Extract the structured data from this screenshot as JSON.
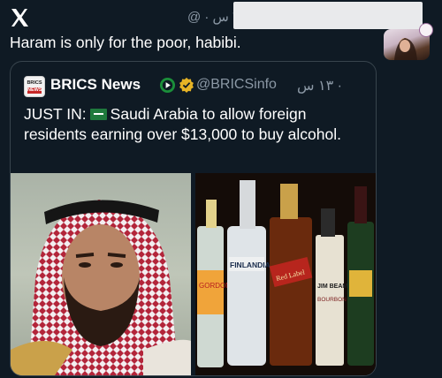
{
  "header": {
    "logo_icon": "x-logo-icon",
    "meta": "٧ س · @"
  },
  "tweet": {
    "text": "Haram is only for the poor, habibi."
  },
  "quote": {
    "avatar_line1": "BRICS",
    "avatar_line2": "NEWS",
    "name": "BRICS News",
    "badge_icons": [
      "play-badge-icon",
      "gold-verified-icon"
    ],
    "handle": "@BRICSinfo",
    "time": "· ١٣ س",
    "text_before_flag": "JUST IN:",
    "flag_icon": "saudi-flag-icon",
    "text_after_flag": "Saudi Arabia to allow foreign residents earning over $13,000 to buy alcohol.",
    "image_left_label": "crown-prince-photo",
    "image_right_label": "alcohol-bottles-photo",
    "bottle_labels": [
      "FINLANDIA",
      "Red Label",
      "JIM BEAM",
      "GORDON'S",
      "BOURBON"
    ]
  },
  "colors": {
    "background": "#0f1a24",
    "border": "#38444d",
    "muted": "#8b98a5",
    "verified_gold": "#e6b325"
  }
}
